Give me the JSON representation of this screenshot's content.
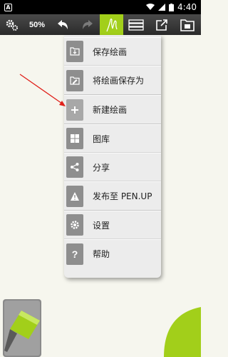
{
  "status_bar": {
    "left_icon": "A",
    "time": "4:40",
    "icons": [
      "wifi-icon",
      "signal-icon",
      "battery-icon"
    ]
  },
  "toolbar": {
    "zoom_label": "50%",
    "buttons": [
      "settings-icon",
      "undo-icon",
      "redo-icon",
      "pen-icon",
      "layers-icon",
      "share-icon",
      "gallery-icon"
    ],
    "accent_color": "#a2cf1a"
  },
  "menu": {
    "items": [
      {
        "label": "保存绘画",
        "icon": "save-icon"
      },
      {
        "label": "将绘画保存为",
        "icon": "save-as-icon"
      },
      {
        "label": "新建绘画",
        "icon": "plus-icon"
      },
      {
        "label": "图库",
        "icon": "grid-icon"
      },
      {
        "label": "分享",
        "icon": "share-icon"
      },
      {
        "label": "发布至 PEN.UP",
        "icon": "warning-icon"
      },
      {
        "label": "设置",
        "icon": "gear-icon"
      },
      {
        "label": "帮助",
        "icon": "question-icon"
      }
    ]
  },
  "colors": {
    "canvas": "#f6f6ee",
    "annotation": "#e0201a",
    "brush_green": "#a2cf1a"
  }
}
